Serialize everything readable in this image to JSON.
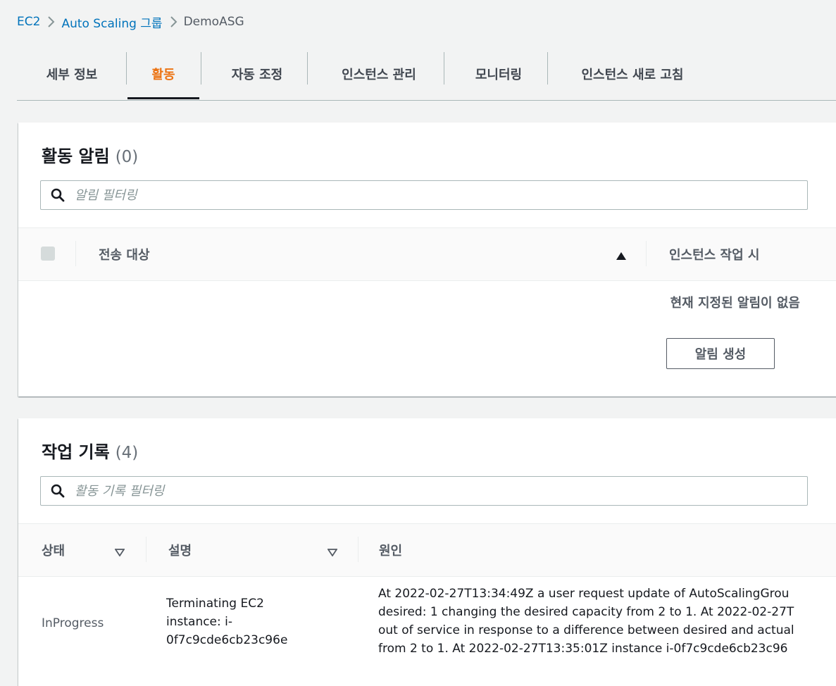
{
  "breadcrumb": {
    "items": [
      "EC2",
      "Auto Scaling 그룹",
      "DemoASG"
    ]
  },
  "tabs": [
    {
      "label": "세부 정보",
      "active": false
    },
    {
      "label": "활동",
      "active": true
    },
    {
      "label": "자동 조정",
      "active": false
    },
    {
      "label": "인스턴스 관리",
      "active": false
    },
    {
      "label": "모니터링",
      "active": false
    },
    {
      "label": "인스턴스 새로 고침",
      "active": false
    }
  ],
  "notifications": {
    "title": "활동 알림",
    "count": "(0)",
    "filter_placeholder": "알림 필터링",
    "columns": [
      "전송 대상",
      "인스턴스 작업 시"
    ],
    "empty_message": "현재 지정된 알림이 없음",
    "create_button": "알림 생성"
  },
  "history": {
    "title": "작업 기록",
    "count": "(4)",
    "filter_placeholder": "활동 기록 필터링",
    "columns": [
      "상태",
      "설명",
      "원인"
    ],
    "rows": [
      {
        "status": "InProgress",
        "description_lines": [
          "Terminating EC2",
          "instance: i-",
          "0f7c9cde6cb23c96e"
        ],
        "cause_lines": [
          "At 2022-02-27T13:34:49Z a user request update of AutoScalingGrou",
          "desired: 1 changing the desired capacity from 2 to 1. At 2022-02-27T",
          "out of service in response to a difference between desired and actual",
          "from 2 to 1. At 2022-02-27T13:35:01Z instance i-0f7c9cde6cb23c96"
        ]
      }
    ]
  },
  "colors": {
    "link": "#0073bb",
    "active_tab": "#ec7211",
    "background": "#f2f3f3"
  }
}
